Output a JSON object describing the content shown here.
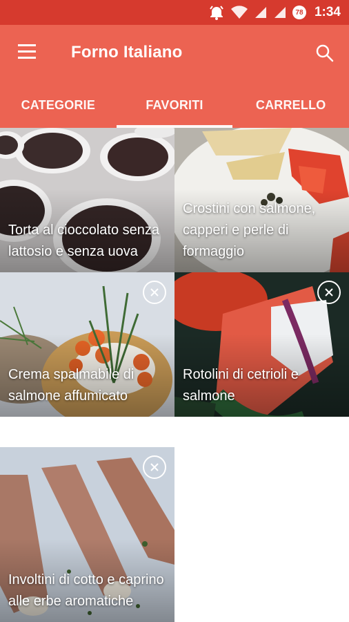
{
  "status_bar": {
    "time": "1:34",
    "battery_badge": "78"
  },
  "app_bar": {
    "title": "Forno Italiano"
  },
  "tabs": [
    {
      "label": "CATEGORIE",
      "active": false
    },
    {
      "label": "FAVORITI",
      "active": true
    },
    {
      "label": "CARRELLO",
      "active": false
    }
  ],
  "favorites": [
    {
      "title": "Torta al cioccolato senza lattosio e senza uova",
      "image": "chocolate-cupcakes"
    },
    {
      "title": "Crostini con salmone, capperi e perle di formaggio",
      "image": "salmon-crostini"
    },
    {
      "title": "Crema spalmabile di salmone affumicato",
      "image": "salmon-spread-on-cracker"
    },
    {
      "title": "Rotolini di cetrioli e salmone",
      "image": "cucumber-salmon-rolls"
    },
    {
      "title": "Involtini di cotto e caprino alle erbe aromatiche",
      "image": "ham-rolls"
    }
  ],
  "colors": {
    "status_bar": "#d63a2e",
    "app_bar": "#ec6352",
    "text_on_primary": "#ffffff"
  },
  "icons": {
    "menu": "hamburger-icon",
    "search": "search-icon",
    "remove": "close-circle-icon"
  }
}
